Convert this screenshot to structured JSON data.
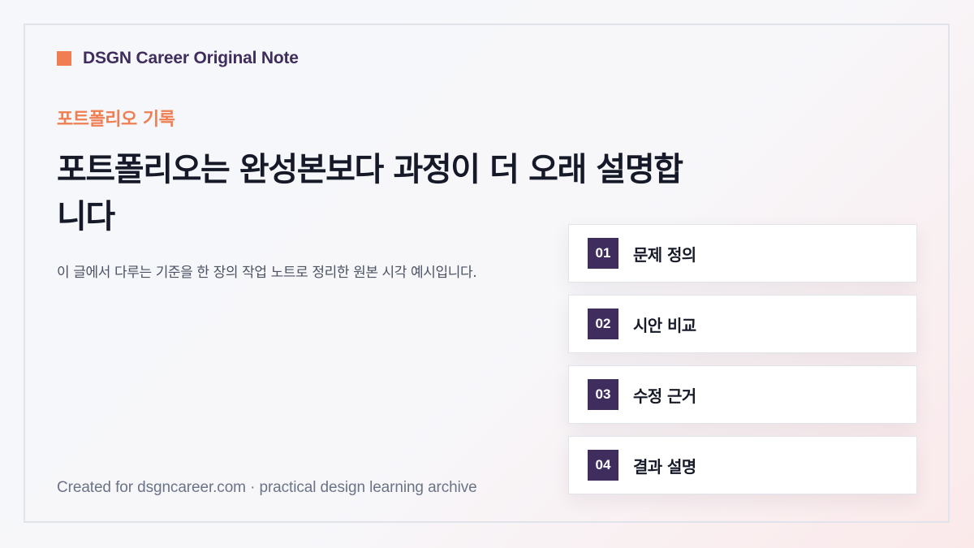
{
  "brand": {
    "name": "DSGN Career Original Note",
    "accent_color": "#ef7f52",
    "primary_color": "#3f2d5e"
  },
  "eyebrow": "포트폴리오 기록",
  "headline": "포트폴리오는 완성본보다 과정이 더 오래 설명합니다",
  "description": "이 글에서 다루는 기준을 한 장의 작업 노트로 정리한 원본 시각 예시입니다.",
  "footer": "Created for dsgncareer.com · practical design learning archive",
  "steps": [
    {
      "number": "01",
      "label": "문제 정의"
    },
    {
      "number": "02",
      "label": "시안 비교"
    },
    {
      "number": "03",
      "label": "수정 근거"
    },
    {
      "number": "04",
      "label": "결과 설명"
    }
  ]
}
